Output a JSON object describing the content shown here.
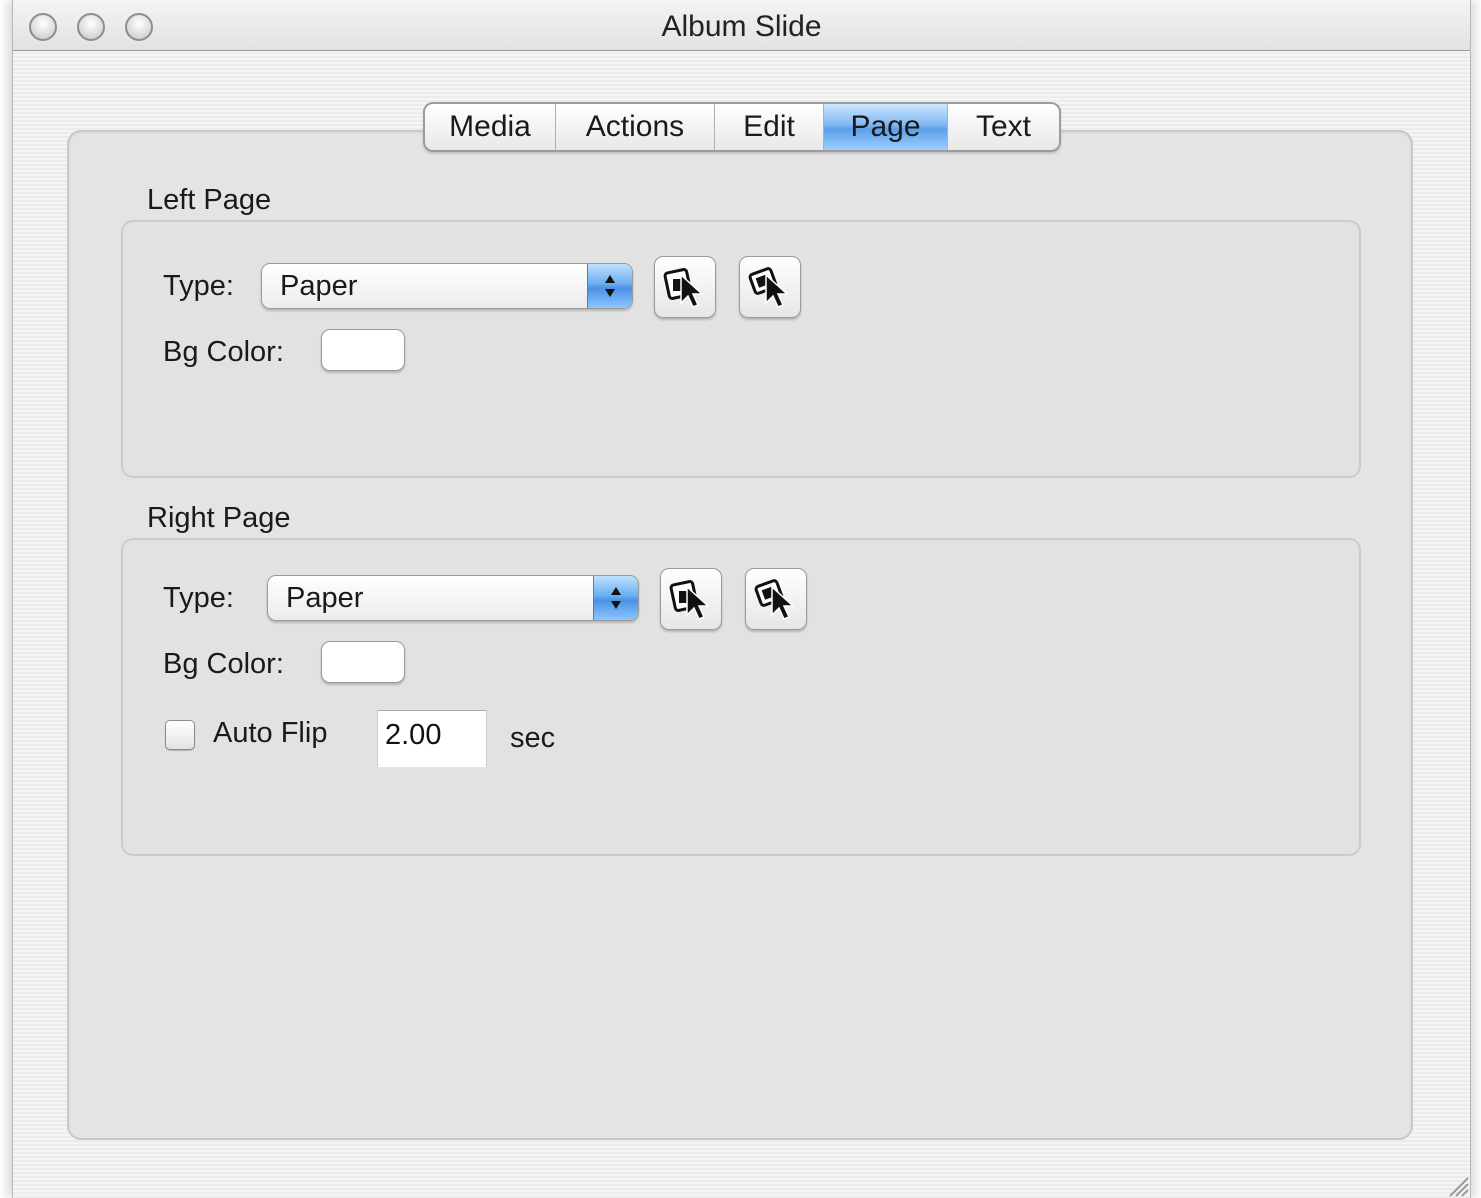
{
  "window": {
    "title": "Album Slide"
  },
  "tabs": [
    {
      "label": "Media"
    },
    {
      "label": "Actions"
    },
    {
      "label": "Edit"
    },
    {
      "label": "Page",
      "selected": true
    },
    {
      "label": "Text"
    }
  ],
  "left_page": {
    "section_title": "Left Page",
    "type_label": "Type:",
    "type_value": "Paper",
    "bg_color_label": "Bg Color:",
    "bg_color": "#ffffff"
  },
  "right_page": {
    "section_title": "Right Page",
    "type_label": "Type:",
    "type_value": "Paper",
    "bg_color_label": "Bg Color:",
    "bg_color": "#ffffff",
    "auto_flip_label": "Auto Flip",
    "auto_flip_checked": false,
    "auto_flip_value": "2.00",
    "auto_flip_unit": "sec"
  },
  "icons": {
    "choose_media": "choose-media-icon",
    "pick_media": "pick-media-icon"
  },
  "colors": {
    "selected_tab": "#6aaef0",
    "panel_bg": "#e4e4e4"
  }
}
